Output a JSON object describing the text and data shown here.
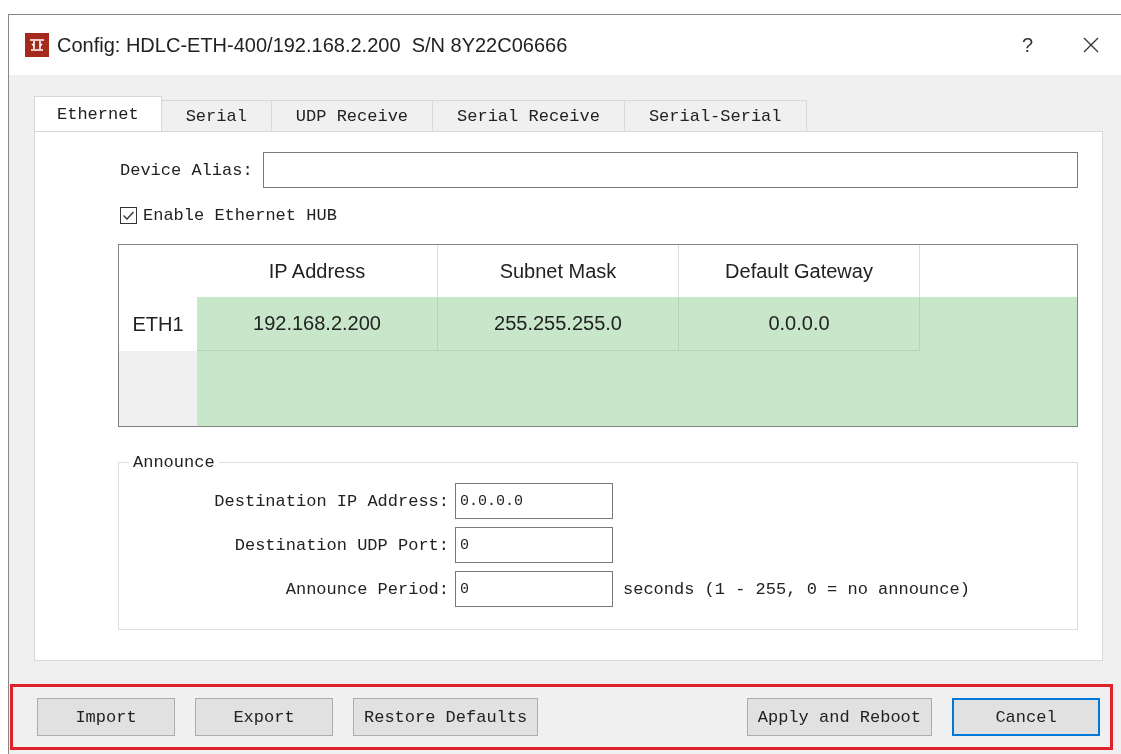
{
  "window": {
    "title": "Config: HDLC-ETH-400/192.168.2.200  S/N 8Y22C06666",
    "help": "?"
  },
  "tabs": [
    {
      "label": "Ethernet",
      "selected": true
    },
    {
      "label": "Serial",
      "selected": false
    },
    {
      "label": "UDP Receive",
      "selected": false
    },
    {
      "label": "Serial Receive",
      "selected": false
    },
    {
      "label": "Serial-Serial",
      "selected": false
    }
  ],
  "device_alias": {
    "label": "Device Alias:"
  },
  "enable_hub": {
    "label": "Enable Ethernet HUB",
    "checked": true
  },
  "table": {
    "columns": [
      "IP Address",
      "Subnet Mask",
      "Default Gateway"
    ],
    "rows": [
      {
        "header": "ETH1",
        "cells": [
          "192.168.2.200",
          "255.255.255.0",
          "0.0.0.0"
        ]
      }
    ]
  },
  "announce": {
    "title": "Announce",
    "fields": [
      {
        "label": "Destination IP Address:",
        "value": "0.0.0.0"
      },
      {
        "label": "Destination UDP Port:",
        "value": "0"
      },
      {
        "label": "Announce Period:",
        "value": "0",
        "suffix": "seconds (1 - 255,  0 = no announce)"
      }
    ]
  },
  "button_bar": {
    "highlighted": true,
    "left_buttons": [
      {
        "label": "Import",
        "default": false
      },
      {
        "label": "Export",
        "default": false
      },
      {
        "label": "Restore Defaults",
        "default": false
      }
    ],
    "right_buttons": [
      {
        "label": "Apply and Reboot",
        "default": false
      },
      {
        "label": "Cancel",
        "default": true
      }
    ]
  }
}
